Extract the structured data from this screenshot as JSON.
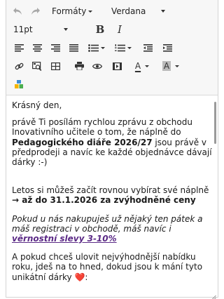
{
  "toolbar": {
    "undo_icon": "undo-icon",
    "redo_icon": "redo-icon",
    "format_label": "Formáty",
    "font_family": "Verdana",
    "font_size": "11pt",
    "bold_label": "B",
    "italic_label": "I",
    "text_color_label": "A",
    "bg_color_label": "A",
    "text_color": "#222222",
    "bg_color": "#bbbbbb"
  },
  "content": {
    "greeting": "Krásný den,",
    "p1_a": "právě Ti posílám rychlou zprávu z obchodu Inovativního učitele o tom, že náplně do ",
    "p1_bold": "Pedagogického diáře 2026/27",
    "p1_b": " jsou právě v předprodeji a navíc ke každé objednávce dávají dárky :-)",
    "p2_a": "Letos si můžeš začít rovnou vybírat své náplně ",
    "p2_bold": "→ až do 31.1.2026 za zvýhodněné ceny",
    "p3_a": "Pokud u nás nakupuješ už nějaký ten pátek a máš registraci v obchodě, máš navíc i ",
    "p3_link": "věrnostní slevy 3-10%",
    "p4_a": "A pokud chceš ulovit nejvýhodnější nabídku roku, jdeš na to hned, dokud jsou k mání tyto unikátní dárky ",
    "p4_heart": "❤️",
    "p4_b": ":"
  }
}
